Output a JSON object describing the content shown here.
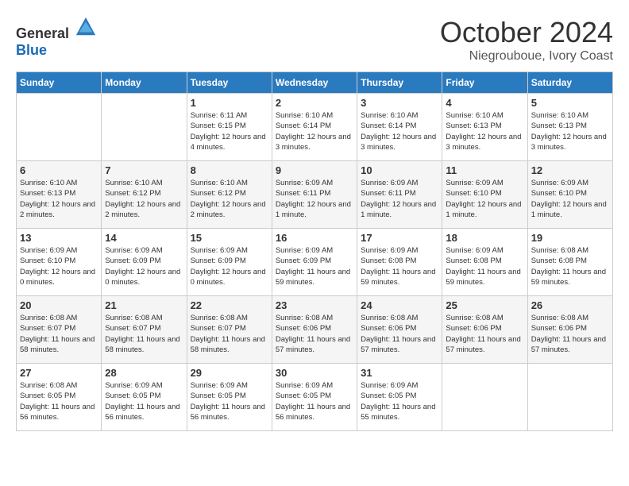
{
  "header": {
    "logo_general": "General",
    "logo_blue": "Blue",
    "month_title": "October 2024",
    "location": "Niegrouboue, Ivory Coast"
  },
  "calendar": {
    "headers": [
      "Sunday",
      "Monday",
      "Tuesday",
      "Wednesday",
      "Thursday",
      "Friday",
      "Saturday"
    ],
    "weeks": [
      [
        {
          "day": "",
          "info": ""
        },
        {
          "day": "",
          "info": ""
        },
        {
          "day": "1",
          "info": "Sunrise: 6:11 AM\nSunset: 6:15 PM\nDaylight: 12 hours and 4 minutes."
        },
        {
          "day": "2",
          "info": "Sunrise: 6:10 AM\nSunset: 6:14 PM\nDaylight: 12 hours and 3 minutes."
        },
        {
          "day": "3",
          "info": "Sunrise: 6:10 AM\nSunset: 6:14 PM\nDaylight: 12 hours and 3 minutes."
        },
        {
          "day": "4",
          "info": "Sunrise: 6:10 AM\nSunset: 6:13 PM\nDaylight: 12 hours and 3 minutes."
        },
        {
          "day": "5",
          "info": "Sunrise: 6:10 AM\nSunset: 6:13 PM\nDaylight: 12 hours and 3 minutes."
        }
      ],
      [
        {
          "day": "6",
          "info": "Sunrise: 6:10 AM\nSunset: 6:13 PM\nDaylight: 12 hours and 2 minutes."
        },
        {
          "day": "7",
          "info": "Sunrise: 6:10 AM\nSunset: 6:12 PM\nDaylight: 12 hours and 2 minutes."
        },
        {
          "day": "8",
          "info": "Sunrise: 6:10 AM\nSunset: 6:12 PM\nDaylight: 12 hours and 2 minutes."
        },
        {
          "day": "9",
          "info": "Sunrise: 6:09 AM\nSunset: 6:11 PM\nDaylight: 12 hours and 1 minute."
        },
        {
          "day": "10",
          "info": "Sunrise: 6:09 AM\nSunset: 6:11 PM\nDaylight: 12 hours and 1 minute."
        },
        {
          "day": "11",
          "info": "Sunrise: 6:09 AM\nSunset: 6:10 PM\nDaylight: 12 hours and 1 minute."
        },
        {
          "day": "12",
          "info": "Sunrise: 6:09 AM\nSunset: 6:10 PM\nDaylight: 12 hours and 1 minute."
        }
      ],
      [
        {
          "day": "13",
          "info": "Sunrise: 6:09 AM\nSunset: 6:10 PM\nDaylight: 12 hours and 0 minutes."
        },
        {
          "day": "14",
          "info": "Sunrise: 6:09 AM\nSunset: 6:09 PM\nDaylight: 12 hours and 0 minutes."
        },
        {
          "day": "15",
          "info": "Sunrise: 6:09 AM\nSunset: 6:09 PM\nDaylight: 12 hours and 0 minutes."
        },
        {
          "day": "16",
          "info": "Sunrise: 6:09 AM\nSunset: 6:09 PM\nDaylight: 11 hours and 59 minutes."
        },
        {
          "day": "17",
          "info": "Sunrise: 6:09 AM\nSunset: 6:08 PM\nDaylight: 11 hours and 59 minutes."
        },
        {
          "day": "18",
          "info": "Sunrise: 6:09 AM\nSunset: 6:08 PM\nDaylight: 11 hours and 59 minutes."
        },
        {
          "day": "19",
          "info": "Sunrise: 6:08 AM\nSunset: 6:08 PM\nDaylight: 11 hours and 59 minutes."
        }
      ],
      [
        {
          "day": "20",
          "info": "Sunrise: 6:08 AM\nSunset: 6:07 PM\nDaylight: 11 hours and 58 minutes."
        },
        {
          "day": "21",
          "info": "Sunrise: 6:08 AM\nSunset: 6:07 PM\nDaylight: 11 hours and 58 minutes."
        },
        {
          "day": "22",
          "info": "Sunrise: 6:08 AM\nSunset: 6:07 PM\nDaylight: 11 hours and 58 minutes."
        },
        {
          "day": "23",
          "info": "Sunrise: 6:08 AM\nSunset: 6:06 PM\nDaylight: 11 hours and 57 minutes."
        },
        {
          "day": "24",
          "info": "Sunrise: 6:08 AM\nSunset: 6:06 PM\nDaylight: 11 hours and 57 minutes."
        },
        {
          "day": "25",
          "info": "Sunrise: 6:08 AM\nSunset: 6:06 PM\nDaylight: 11 hours and 57 minutes."
        },
        {
          "day": "26",
          "info": "Sunrise: 6:08 AM\nSunset: 6:06 PM\nDaylight: 11 hours and 57 minutes."
        }
      ],
      [
        {
          "day": "27",
          "info": "Sunrise: 6:08 AM\nSunset: 6:05 PM\nDaylight: 11 hours and 56 minutes."
        },
        {
          "day": "28",
          "info": "Sunrise: 6:09 AM\nSunset: 6:05 PM\nDaylight: 11 hours and 56 minutes."
        },
        {
          "day": "29",
          "info": "Sunrise: 6:09 AM\nSunset: 6:05 PM\nDaylight: 11 hours and 56 minutes."
        },
        {
          "day": "30",
          "info": "Sunrise: 6:09 AM\nSunset: 6:05 PM\nDaylight: 11 hours and 56 minutes."
        },
        {
          "day": "31",
          "info": "Sunrise: 6:09 AM\nSunset: 6:05 PM\nDaylight: 11 hours and 55 minutes."
        },
        {
          "day": "",
          "info": ""
        },
        {
          "day": "",
          "info": ""
        }
      ]
    ]
  }
}
